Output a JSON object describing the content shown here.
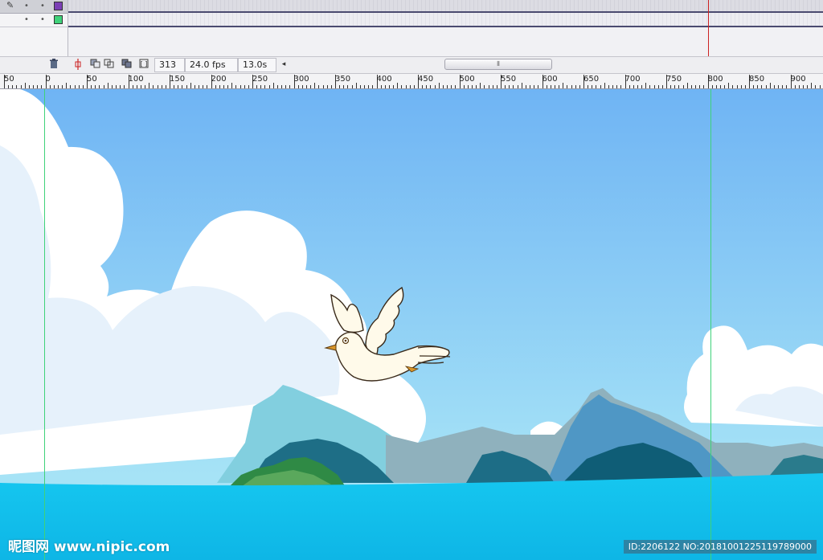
{
  "timeline": {
    "layers": [
      {
        "color": "#7b3fb5"
      },
      {
        "color": "#3fd27a"
      }
    ],
    "playhead_color": "#cc2222"
  },
  "statusbar": {
    "current_frame": "313",
    "frame_rate": "24.0 fps",
    "elapsed_time": "13.0s",
    "scroll_left_glyph": "◂",
    "scroll_thumb_glyph": "⦀"
  },
  "ruler": {
    "labels": [
      "50",
      "0",
      "50",
      "100",
      "150",
      "200",
      "250",
      "300",
      "350",
      "400",
      "450",
      "500",
      "550",
      "600",
      "650",
      "700",
      "750",
      "800",
      "850",
      "900"
    ]
  },
  "stage": {
    "sky_top": "#6fb4f4",
    "sky_bottom": "#a6e3f6",
    "sea": "#13c4ee",
    "guide_color": "#3fd27a"
  },
  "watermark": {
    "site": "昵图网 www.nipic.com",
    "id_text": "ID:2206122 NO:20181001225119789000"
  }
}
